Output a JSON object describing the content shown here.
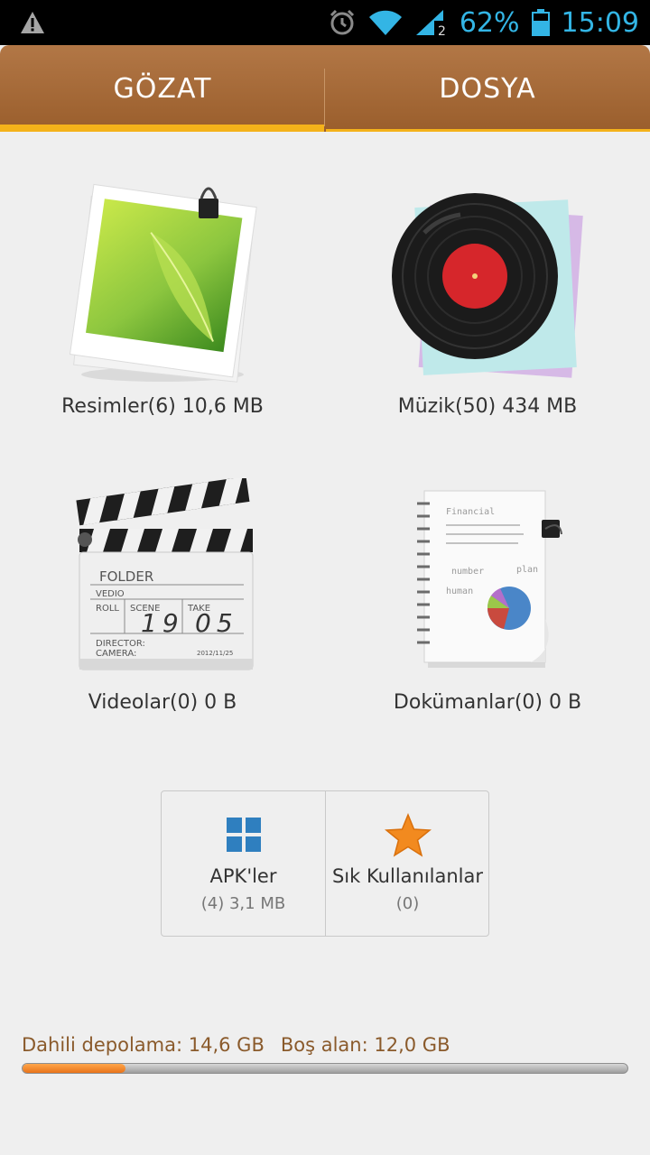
{
  "status_bar": {
    "battery": "62%",
    "time": "15:09"
  },
  "tabs": [
    {
      "label": "GÖZAT"
    },
    {
      "label": "DOSYA"
    }
  ],
  "categories": [
    {
      "label": "Resimler(6) 10,6 MB",
      "icon": "photo-icon"
    },
    {
      "label": "Müzik(50) 434 MB",
      "icon": "vinyl-record-icon"
    },
    {
      "label": "Videolar(0) 0 B",
      "icon": "clapperboard-icon"
    },
    {
      "label": "Dokümanlar(0) 0 B",
      "icon": "notebook-icon"
    }
  ],
  "clapper_text": {
    "folder": "FOLDER",
    "vedio": "VEDIO",
    "roll": "ROLL",
    "scene": "SCENE",
    "take": "TAKE",
    "num1": "19",
    "num2": "05",
    "director": "DIRECTOR:",
    "camera": "CAMERA:",
    "date": "2012/11/25"
  },
  "notebook_text": {
    "title": "Financial",
    "number": "number",
    "plan": "plan",
    "human": "human"
  },
  "shortcuts": [
    {
      "title": "APK'ler",
      "sub": "(4) 3,1 MB",
      "icon": "apps-grid-icon"
    },
    {
      "title": "Sık Kullanılanlar",
      "sub": "(0)",
      "icon": "star-icon"
    }
  ],
  "storage": {
    "internal_label": "Dahili depolama: 14,6 GB",
    "free_label": "Boş alan: 12,0 GB",
    "used_fraction": 0.17
  },
  "colors": {
    "accent": "#f4b21a",
    "tab_bar": "#a5683a",
    "storage_text": "#8a5a2b",
    "status_blue": "#33b5e5"
  }
}
